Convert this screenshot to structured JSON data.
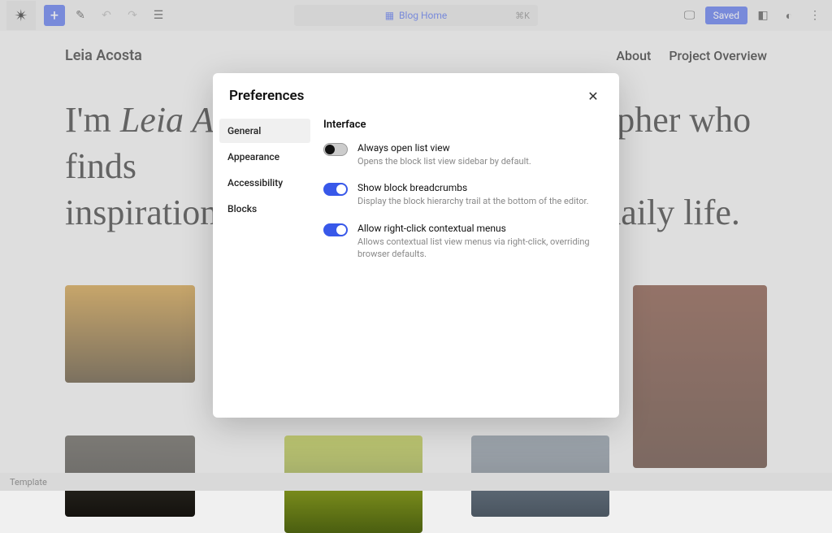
{
  "toolbar": {
    "crumb_label": "Blog Home",
    "crumb_kbd": "⌘K",
    "saved_label": "Saved"
  },
  "page": {
    "site_title": "Leia Acosta",
    "nav": {
      "about": "About",
      "overview": "Project Overview"
    },
    "hero_line1_pre": "I'm ",
    "hero_line1_em": "Leia Acosta",
    "hero_line1_post": ", a passionate photographer who finds",
    "hero_line2": "inspiration in capturing the beauty of daily life."
  },
  "bottom_bar": {
    "label": "Template"
  },
  "modal": {
    "title": "Preferences",
    "tabs": [
      {
        "label": "General",
        "active": true
      },
      {
        "label": "Appearance",
        "active": false
      },
      {
        "label": "Accessibility",
        "active": false
      },
      {
        "label": "Blocks",
        "active": false
      }
    ],
    "section_title": "Interface",
    "prefs": [
      {
        "on": false,
        "label": "Always open list view",
        "desc": "Opens the block list view sidebar by default."
      },
      {
        "on": true,
        "label": "Show block breadcrumbs",
        "desc": "Display the block hierarchy trail at the bottom of the editor."
      },
      {
        "on": true,
        "label": "Allow right-click contextual menus",
        "desc": "Allows contextual list view menus via right-click, overriding browser defaults."
      }
    ]
  }
}
